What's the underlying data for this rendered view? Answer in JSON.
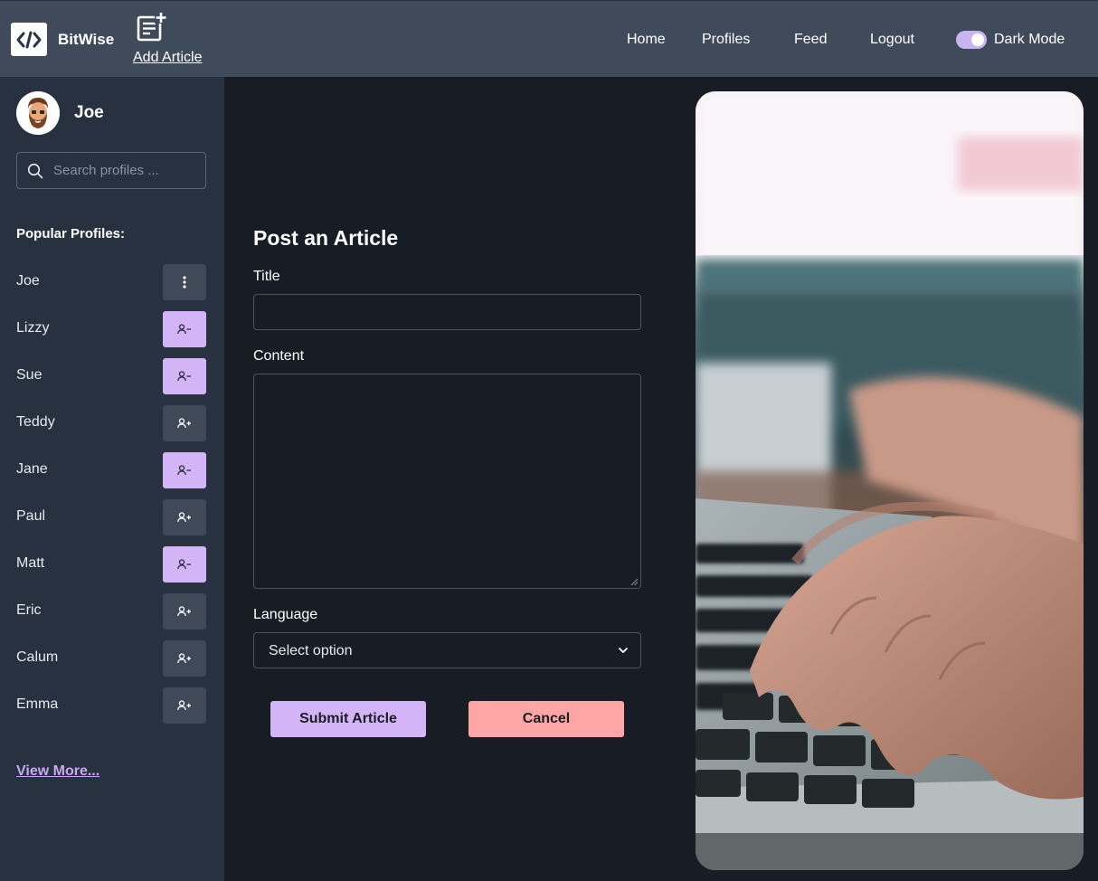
{
  "header": {
    "brand": "BitWise",
    "add_article_label": "Add Article",
    "nav": [
      "Home",
      "Profiles",
      "Feed",
      "Logout"
    ],
    "dark_mode_label": "Dark Mode",
    "dark_mode_on": true
  },
  "sidebar": {
    "username": "Joe",
    "search_placeholder": "Search profiles ...",
    "popular_title": "Popular Profiles:",
    "profiles": [
      {
        "name": "Joe",
        "action": "more-icon"
      },
      {
        "name": "Lizzy",
        "action": "unfollow-icon"
      },
      {
        "name": "Sue",
        "action": "unfollow-icon"
      },
      {
        "name": "Teddy",
        "action": "follow-icon"
      },
      {
        "name": "Jane",
        "action": "unfollow-icon"
      },
      {
        "name": "Paul",
        "action": "follow-icon"
      },
      {
        "name": "Matt",
        "action": "unfollow-icon"
      },
      {
        "name": "Eric",
        "action": "follow-icon"
      },
      {
        "name": "Calum",
        "action": "follow-icon"
      },
      {
        "name": "Emma",
        "action": "follow-icon"
      }
    ],
    "view_more": "View More..."
  },
  "form": {
    "title": "Post an Article",
    "title_label": "Title",
    "title_value": "",
    "content_label": "Content",
    "content_value": "",
    "language_label": "Language",
    "language_value": "Select option",
    "submit_label": "Submit Article",
    "cancel_label": "Cancel"
  },
  "colors": {
    "header_bg": "#3f4b5b",
    "sidebar_bg": "#283140",
    "page_bg": "#181d25",
    "accent_purple": "#d2b4f7",
    "cancel_pink": "#fea6a6",
    "link_purple": "#c8a8f2"
  }
}
